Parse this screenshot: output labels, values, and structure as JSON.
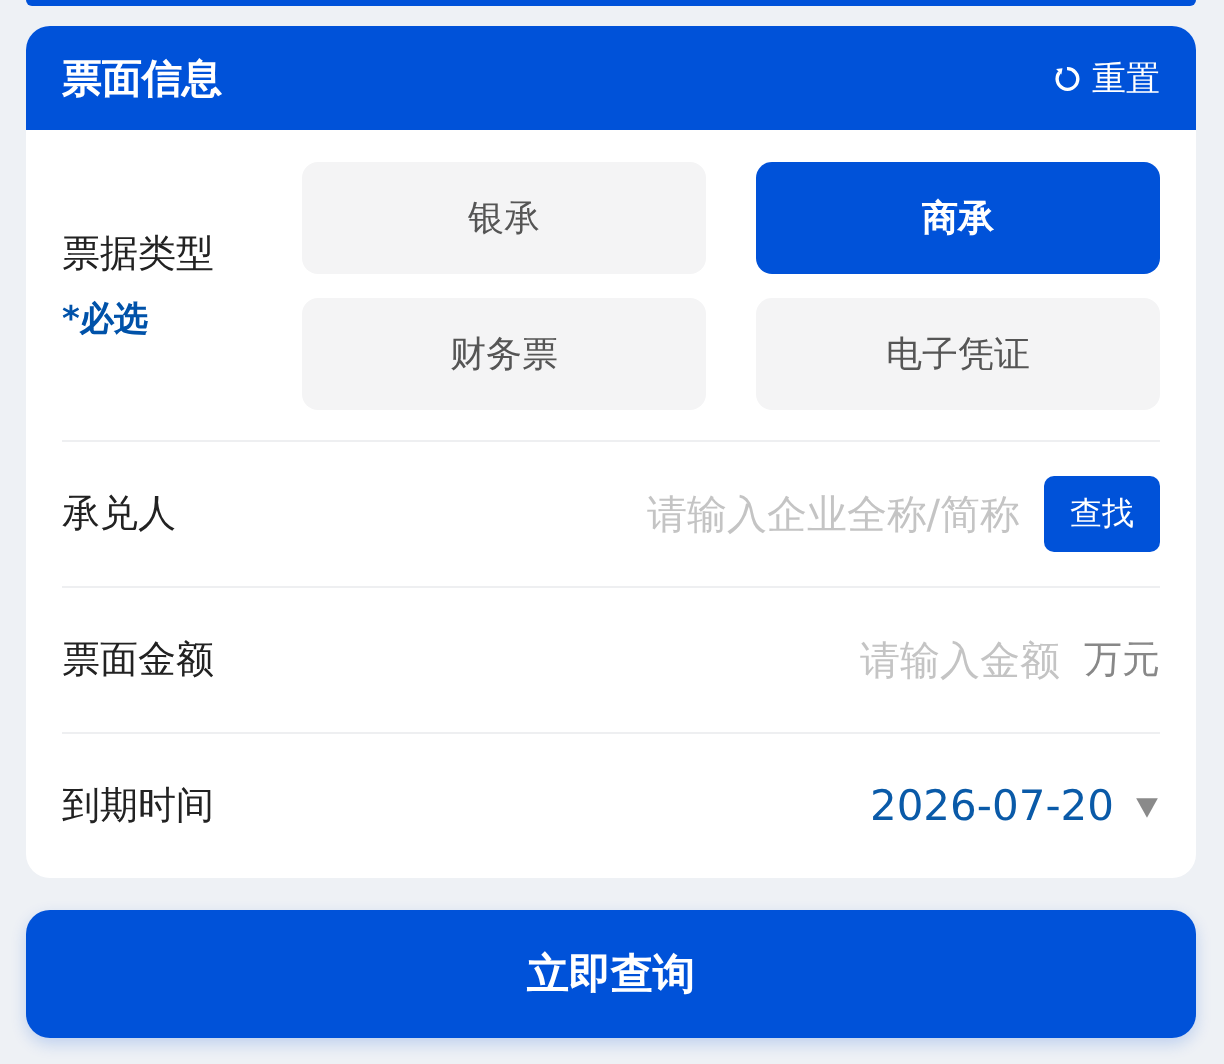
{
  "header": {
    "title": "票面信息",
    "reset_label": "重置"
  },
  "bill_type": {
    "label": "票据类型",
    "required": "*必选",
    "options": [
      {
        "label": "银承",
        "selected": false
      },
      {
        "label": "商承",
        "selected": true
      },
      {
        "label": "财务票",
        "selected": false
      },
      {
        "label": "电子凭证",
        "selected": false
      }
    ]
  },
  "acceptor": {
    "label": "承兑人",
    "placeholder": "请输入企业全称/简称",
    "button": "查找"
  },
  "amount": {
    "label": "票面金额",
    "placeholder": "请输入金额",
    "unit": "万元"
  },
  "due_date": {
    "label": "到期时间",
    "value": "2026-07-20"
  },
  "submit": "立即查询"
}
